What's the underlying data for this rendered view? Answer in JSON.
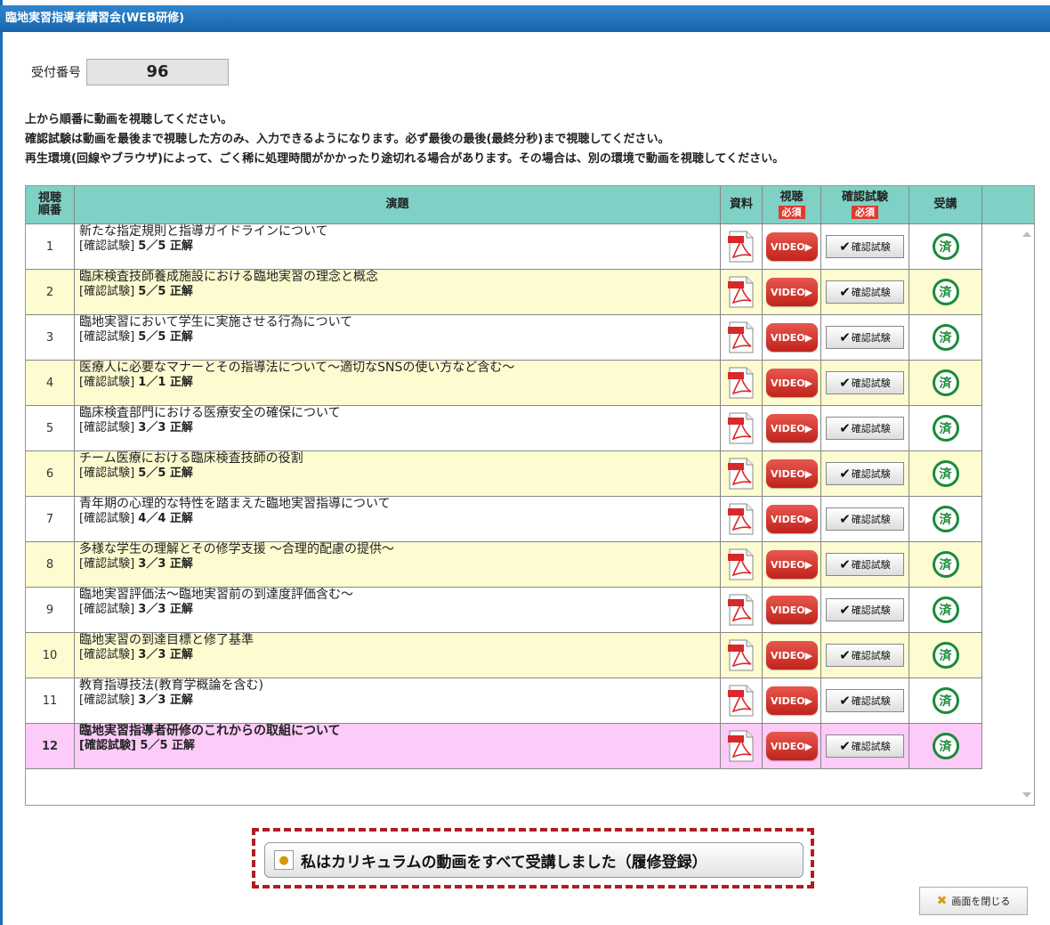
{
  "window": {
    "title": "臨地実習指導者講習会(WEB研修)"
  },
  "receipt": {
    "label": "受付番号",
    "value": "96"
  },
  "notes": [
    "上から順番に動画を視聴してください。",
    "確認試験は動画を最後まで視聴した方のみ、入力できるようになります。必ず最後の最後(最終分秒)まで視聴してください。",
    "再生環境(回線やブラウザ)によって、ごく稀に処理時間がかかったり途切れる場合があります。その場合は、別の環境で動画を視聴してください。"
  ],
  "table": {
    "headers": {
      "order_line1": "視聴",
      "order_line2": "順番",
      "title": "演題",
      "doc": "資料",
      "video": "視聴",
      "video_req": "必須",
      "test": "確認試験",
      "test_req": "必須",
      "attend": "受講"
    },
    "button_labels": {
      "video": "VIDEO▶",
      "test": "確認試験",
      "done": "済"
    },
    "rows": [
      {
        "num": "1",
        "title": "新たな指定規則と指導ガイドラインについて",
        "result_prefix": "[確認試験]",
        "result": "5／5 正解"
      },
      {
        "num": "2",
        "title": "臨床検査技師養成施設における臨地実習の理念と概念",
        "result_prefix": "[確認試験]",
        "result": "5／5 正解"
      },
      {
        "num": "3",
        "title": "臨地実習において学生に実施させる行為について",
        "result_prefix": "[確認試験]",
        "result": "5／5 正解"
      },
      {
        "num": "4",
        "title": "医療人に必要なマナーとその指導法について～適切なSNSの使い方など含む～",
        "result_prefix": "[確認試験]",
        "result": "1／1 正解"
      },
      {
        "num": "5",
        "title": "臨床検査部門における医療安全の確保について",
        "result_prefix": "[確認試験]",
        "result": "3／3 正解"
      },
      {
        "num": "6",
        "title": "チーム医療における臨床検査技師の役割",
        "result_prefix": "[確認試験]",
        "result": "5／5 正解"
      },
      {
        "num": "7",
        "title": "青年期の心理的な特性を踏まえた臨地実習指導について",
        "result_prefix": "[確認試験]",
        "result": "4／4 正解"
      },
      {
        "num": "8",
        "title": "多様な学生の理解とその修学支援 ～合理的配慮の提供～",
        "result_prefix": "[確認試験]",
        "result": "3／3 正解"
      },
      {
        "num": "9",
        "title": "臨地実習評価法～臨地実習前の到達度評価含む～",
        "result_prefix": "[確認試験]",
        "result": "3／3 正解"
      },
      {
        "num": "10",
        "title": "臨地実習の到達目標と修了基準",
        "result_prefix": "[確認試験]",
        "result": "3／3 正解"
      },
      {
        "num": "11",
        "title": "教育指導技法(教育学概論を含む)",
        "result_prefix": "[確認試験]",
        "result": "3／3 正解"
      },
      {
        "num": "12",
        "title": "臨地実習指導者研修のこれからの取組について",
        "result_prefix": "[確認試験]",
        "result": "5／5 正解"
      }
    ]
  },
  "complete_button": {
    "label": "私はカリキュラムの動画をすべて受講しました（履修登録）"
  },
  "close_button": {
    "label": "画面を閉じる"
  },
  "colors": {
    "header": "#7fd0c5",
    "even_row": "#fdfbd0",
    "current_row": "#fccbf8",
    "accent_red": "#b01e1e"
  }
}
